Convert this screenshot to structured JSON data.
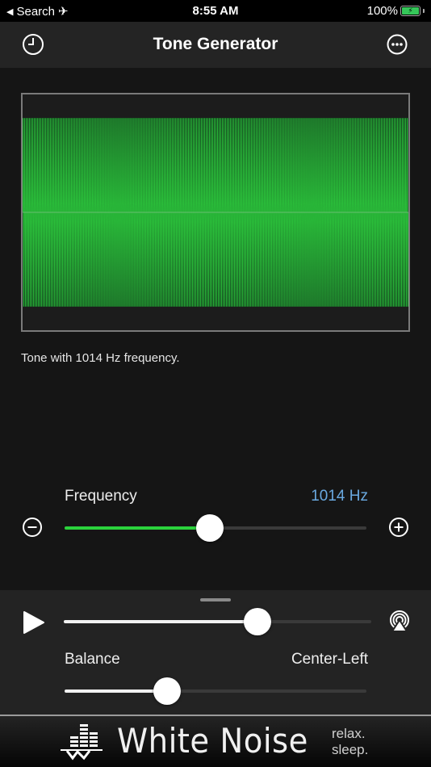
{
  "status_bar": {
    "back_app": "Search",
    "time": "8:55 AM",
    "battery_percent": "100%",
    "battery_level": 1.0,
    "charging": true,
    "airplane_mode": true
  },
  "nav": {
    "title": "Tone Generator",
    "left_icon": "clock-icon",
    "right_icon": "more-icon"
  },
  "waveform": {
    "color": "#2bc23b",
    "frequency_hz": 1014,
    "amplitude_fraction": 0.8
  },
  "tone_description": "Tone with 1014 Hz frequency.",
  "frequency": {
    "label": "Frequency",
    "value_text": "1014 Hz",
    "slider_fraction": 0.48,
    "accent_color": "#2bd23c",
    "value_color": "#6aa9e0"
  },
  "player": {
    "play_icon": "play-icon",
    "airplay_icon": "airplay-icon",
    "volume_fraction": 0.63
  },
  "balance": {
    "label": "Balance",
    "value_text": "Center-Left",
    "slider_fraction": 0.34
  },
  "ad_banner": {
    "brand": "White Noise",
    "tagline_line1": "relax.",
    "tagline_line2": "sleep."
  }
}
